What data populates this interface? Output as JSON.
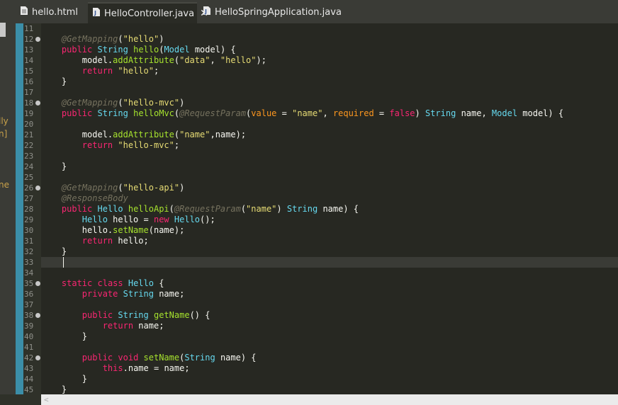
{
  "left_fragments": [
    "lly",
    "n]",
    "ne"
  ],
  "tabs": [
    {
      "label": "hello.html",
      "icon": "html-file-icon"
    },
    {
      "label": "HelloController.java",
      "icon": "java-file-icon",
      "close": "✕",
      "active": true
    },
    {
      "label": "HelloSpringApplication.java",
      "icon": "java-file-icon"
    }
  ],
  "colors": {
    "editor_bg": "#272822",
    "keyword": "#f92672",
    "type": "#66d9ef",
    "string": "#e6db74",
    "annotation": "#75715e",
    "function": "#a6e22e",
    "variable": "#fd971f",
    "plain": "#f8f8f2",
    "param": "#66d9ef",
    "gutter_marker": "#3b8ea8"
  },
  "lines": [
    {
      "n": "11",
      "text": ""
    },
    {
      "n": "12",
      "fold": true,
      "text": "    @GetMapping(\"hello\")"
    },
    {
      "n": "13",
      "text": "    public String hello(Model model) {"
    },
    {
      "n": "14",
      "text": "        model.addAttribute(\"data\", \"hello\");"
    },
    {
      "n": "15",
      "text": "        return \"hello\";"
    },
    {
      "n": "16",
      "text": "    }"
    },
    {
      "n": "17",
      "text": ""
    },
    {
      "n": "18",
      "fold": true,
      "text": "    @GetMapping(\"hello-mvc\")"
    },
    {
      "n": "19",
      "text": "    public String helloMvc(@RequestParam(value = \"name\", required = false) String name, Model model) {"
    },
    {
      "n": "20",
      "text": ""
    },
    {
      "n": "21",
      "text": "        model.addAttribute(\"name\",name);"
    },
    {
      "n": "22",
      "text": "        return \"hello-mvc\";"
    },
    {
      "n": "23",
      "text": ""
    },
    {
      "n": "24",
      "text": "    }"
    },
    {
      "n": "25",
      "text": ""
    },
    {
      "n": "26",
      "fold": true,
      "text": "    @GetMapping(\"hello-api\")"
    },
    {
      "n": "27",
      "text": "    @ResponseBody"
    },
    {
      "n": "28",
      "text": "    public Hello helloApi(@RequestParam(\"name\") String name) {"
    },
    {
      "n": "29",
      "text": "        Hello hello = new Hello();"
    },
    {
      "n": "30",
      "text": "        hello.setName(name);"
    },
    {
      "n": "31",
      "text": "        return hello;"
    },
    {
      "n": "32",
      "text": "    }"
    },
    {
      "n": "33",
      "text": "",
      "current": true
    },
    {
      "n": "34",
      "text": ""
    },
    {
      "n": "35",
      "fold": true,
      "text": "    static class Hello {"
    },
    {
      "n": "36",
      "text": "        private String name;"
    },
    {
      "n": "37",
      "text": ""
    },
    {
      "n": "38",
      "fold": true,
      "text": "        public String getName() {"
    },
    {
      "n": "39",
      "text": "            return name;"
    },
    {
      "n": "40",
      "text": "        }"
    },
    {
      "n": "41",
      "text": ""
    },
    {
      "n": "42",
      "fold": true,
      "text": "        public void setName(String name) {"
    },
    {
      "n": "43",
      "text": "            this.name = name;"
    },
    {
      "n": "44",
      "text": "        }"
    },
    {
      "n": "45",
      "text": "    }"
    }
  ],
  "scroll": {
    "left_arrow": "<"
  }
}
